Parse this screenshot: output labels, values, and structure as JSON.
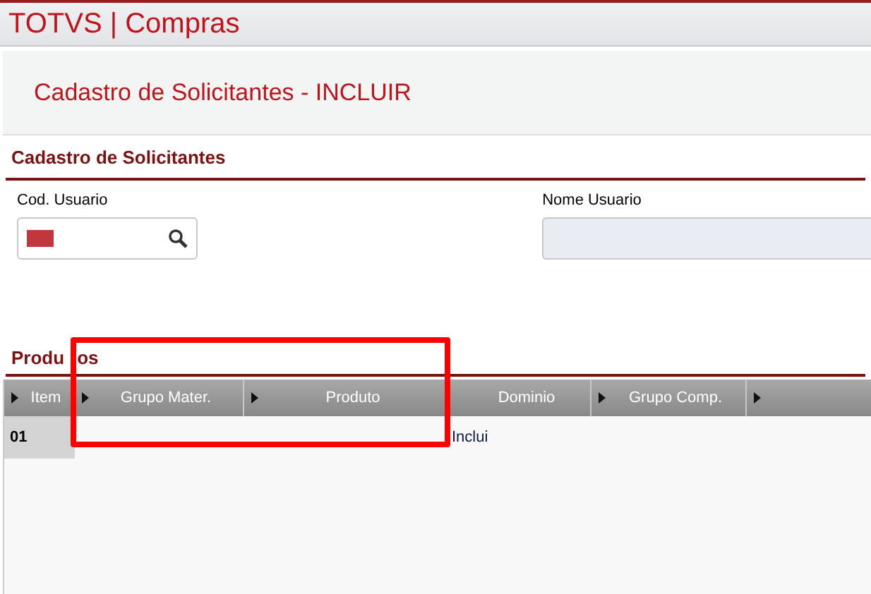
{
  "app_title": "TOTVS | Compras",
  "page_title": "Cadastro de Solicitantes - INCLUIR",
  "form": {
    "title": "Cadastro de Solicitantes",
    "fields": [
      {
        "label": "Cod. Usuario",
        "kind": "lookup",
        "required": true,
        "disabled": false
      },
      {
        "label": "Nome Usuario",
        "kind": "text",
        "required": false,
        "disabled": true
      }
    ]
  },
  "grid": {
    "title_parts": [
      "Produ",
      "os"
    ],
    "columns": [
      {
        "label": "Item",
        "sortable": true
      },
      {
        "label": "Grupo Mater.",
        "sortable": true
      },
      {
        "label": "Produto",
        "sortable": true
      },
      {
        "label": "Dominio",
        "sortable": false
      },
      {
        "label": "Grupo Comp.",
        "sortable": true
      },
      {
        "sortable": true
      }
    ],
    "rows": [
      [
        "01",
        null,
        null,
        "Inclui",
        null
      ]
    ]
  },
  "highlight": {
    "shown": true
  }
}
